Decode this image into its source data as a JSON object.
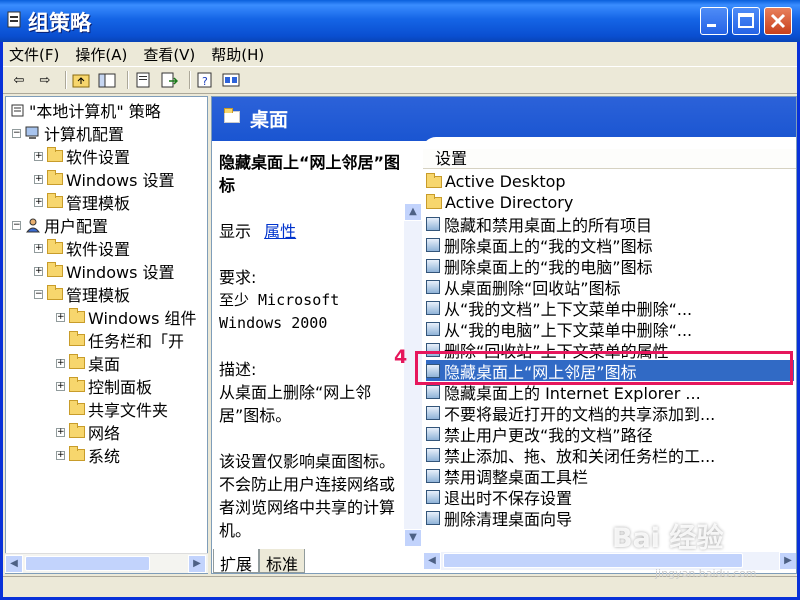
{
  "window": {
    "title": "组策略"
  },
  "menu": [
    "文件(F)",
    "操作(A)",
    "查看(V)",
    "帮助(H)"
  ],
  "toolbar": {
    "icons": [
      "back-arrow-icon",
      "forward-arrow-icon",
      "up-folder-icon",
      "show-tree-icon",
      "properties-icon",
      "export-icon",
      "help-icon",
      "console-icon"
    ]
  },
  "tree": {
    "root": "\"本地计算机\" 策略",
    "computer_config": "计算机配置",
    "cc_software": "软件设置",
    "cc_windows": "Windows 设置",
    "cc_admin": "管理模板",
    "user_config": "用户配置",
    "uc_software": "软件设置",
    "uc_windows": "Windows 设置",
    "uc_admin": "管理模板",
    "windows_components": "Windows 组件",
    "taskbar": "任务栏和「开",
    "desktop": "桌面",
    "control_panel": "控制面板",
    "shared_folders": "共享文件夹",
    "network": "网络",
    "system": "系统"
  },
  "right": {
    "header": "桌面",
    "desc_title": "隐藏桌面上“网上邻居”图标",
    "show_label": "显示",
    "properties_link": "属性",
    "requirement_label": "要求:",
    "requirement_line1": "至少 Microsoft",
    "requirement_line2": "Windows 2000",
    "description_label": "描述:",
    "description_text": "从桌面上删除“网上邻居”图标。",
    "description_more": "该设置仅影响桌面图标。不会防止用户连接网络或者浏览网络中共享的计算机。"
  },
  "list": {
    "column_header": "设置",
    "items": [
      "Active Desktop",
      "Active Directory",
      "隐藏和禁用桌面上的所有项目",
      "删除桌面上的“我的文档”图标",
      "删除桌面上的“我的电脑”图标",
      "从桌面删除“回收站”图标",
      "从“我的文档”上下文菜单中删除“...",
      "从“我的电脑”上下文菜单中删除“...",
      "删除“回收站”上下文菜单的属性",
      "隐藏桌面上“网上邻居”图标",
      "隐藏桌面上的 Internet Explorer ...",
      "不要将最近打开的文档的共享添加到...",
      "禁止用户更改“我的文档”路径",
      "禁止添加、拖、放和关闭任务栏的工...",
      "禁用调整桌面工具栏",
      "退出时不保存设置",
      "删除清理桌面向导"
    ],
    "selected_index": 9
  },
  "annotation": {
    "step": "4"
  },
  "tabs": [
    "扩展",
    "标准"
  ],
  "watermark": {
    "text": "Bai 经验",
    "sub": "jingyan.baidu.com"
  }
}
